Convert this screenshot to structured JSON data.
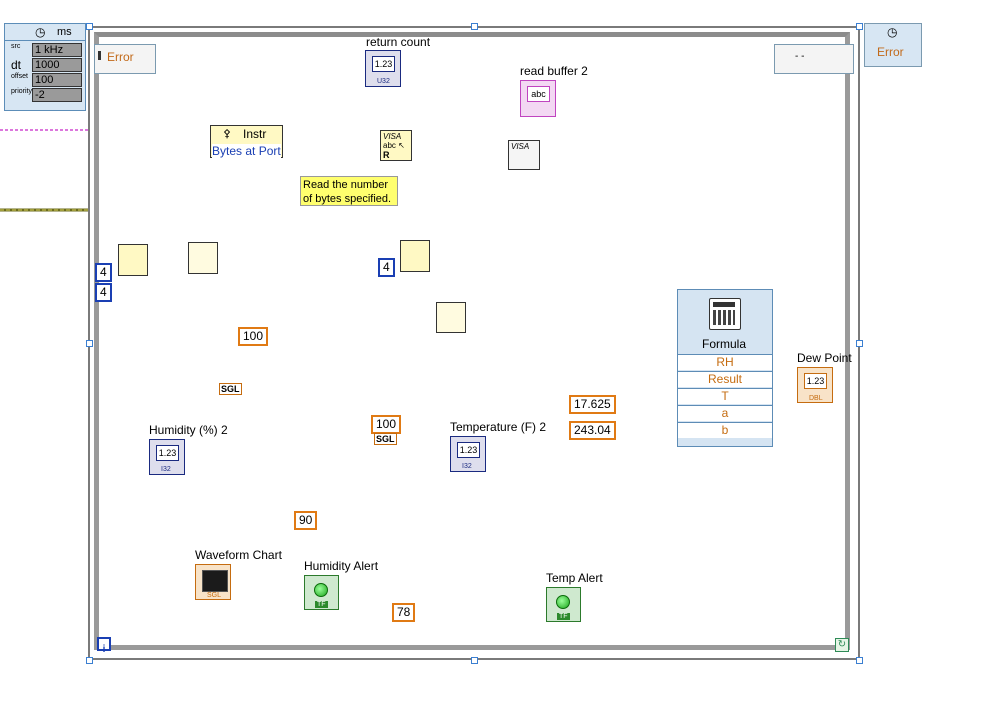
{
  "timing": {
    "header_unit": "ms",
    "rows": [
      {
        "key": "src",
        "value": "1 kHz"
      },
      {
        "key": "dt",
        "value": "1000"
      },
      {
        "key": "offset",
        "value": "100"
      },
      {
        "key": "priority",
        "value": "-2"
      }
    ]
  },
  "error_in": {
    "label": "Error"
  },
  "error_out": {
    "label": "Error"
  },
  "labels": {
    "return_count": "return count",
    "read_buffer": "read buffer 2",
    "humidity": "Humidity (%) 2",
    "temperature": "Temperature (F) 2",
    "waveform_chart": "Waveform Chart",
    "humidity_alert": "Humidity Alert",
    "temp_alert": "Temp Alert",
    "dew_point": "Dew Point"
  },
  "property_node": {
    "class": "Instr",
    "property": "Bytes at Port"
  },
  "comment": {
    "text": "Read the number of bytes specified."
  },
  "constants": {
    "c4a": "4",
    "c4b": "4",
    "c4c": "4",
    "c100a": "100",
    "c100b": "100",
    "c90": "90",
    "c78": "78",
    "c17": "17.625",
    "c243": "243.04"
  },
  "formula": {
    "title": "Formula",
    "rows": [
      "RH",
      "Result",
      "T",
      "a",
      "b"
    ]
  },
  "indicator_text": {
    "num": "1.23",
    "str": "abc",
    "sgl": "SGL",
    "dbl": "DBL",
    "u32": "U32",
    "i32": "I32",
    "tf": "TF"
  },
  "loop_info": {
    "iteration": "i"
  },
  "colors": {
    "wire_orange": "#e5922e",
    "wire_pink": "#d049d0",
    "wire_blue": "#1a3fb3",
    "wire_green": "#2e8b57",
    "highlight": "#e21d1d"
  }
}
